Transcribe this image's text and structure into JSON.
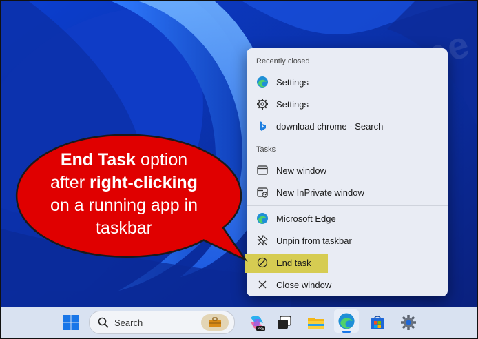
{
  "menu": {
    "recently_closed_title": "Recently closed",
    "recent": [
      {
        "label": "Settings",
        "icon": "edge-icon"
      },
      {
        "label": "Settings",
        "icon": "gear-icon"
      },
      {
        "label": "download chrome - Search",
        "icon": "bing-icon"
      }
    ],
    "tasks_title": "Tasks",
    "tasks": [
      {
        "label": "New window",
        "icon": "window-icon"
      },
      {
        "label": "New InPrivate window",
        "icon": "inprivate-icon"
      }
    ],
    "actions": [
      {
        "label": "Microsoft Edge",
        "icon": "edge-icon"
      },
      {
        "label": "Unpin from taskbar",
        "icon": "unpin-icon"
      },
      {
        "label": "End task",
        "icon": "prohibit-icon"
      },
      {
        "label": "Close window",
        "icon": "close-icon"
      }
    ]
  },
  "callout": {
    "line1_bold": "End Task",
    "line1_rest": " option",
    "line2_pre": "after ",
    "line2_bold": "right-clicking",
    "line3": "on a running app in",
    "line4": "taskbar"
  },
  "taskbar": {
    "search_placeholder": "Search",
    "icons": [
      "windows-start-icon",
      "search-icon",
      "briefcase-icon",
      "copilot-pre-icon",
      "task-view-icon",
      "file-explorer-icon",
      "edge-icon",
      "store-icon",
      "settings-gear-icon"
    ]
  },
  "watermark": "ottra.ne",
  "colors": {
    "callout_red": "#e00000",
    "highlight": "#d6cc52",
    "menu_bg": "#e9ecf4"
  }
}
